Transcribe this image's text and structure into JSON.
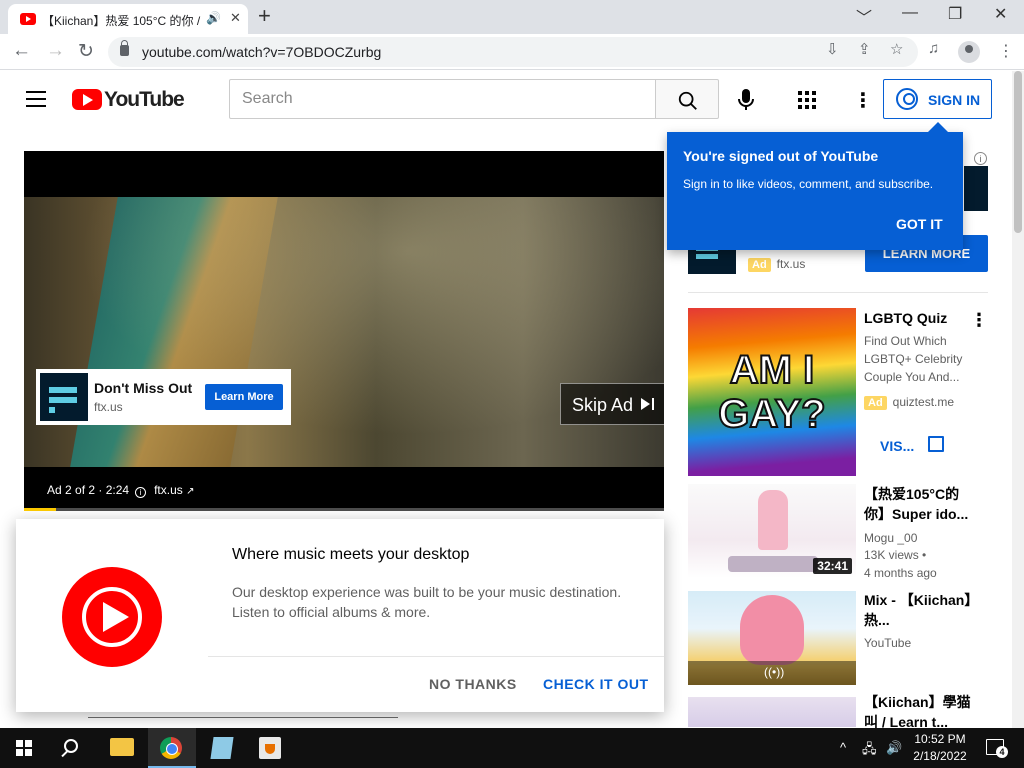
{
  "browser": {
    "tab_title": "【Kiichan】热爱 105°C 的你 /",
    "tab_audio_icon": "speaker-icon",
    "tab_close": "✕",
    "new_tab": "+",
    "window": {
      "minimize": "﹀",
      "min": "—",
      "restore": "❐",
      "close": "✕"
    },
    "nav": {
      "back": "←",
      "forward": "→",
      "reload": "↻"
    },
    "url": "youtube.com/watch?v=7OBDOCZurbg",
    "omni_icons": [
      "install-icon",
      "share-icon",
      "star-icon",
      "media-control-icon"
    ],
    "menu": "⋮"
  },
  "youtube": {
    "wordmark": "YouTube",
    "search_placeholder": "Search",
    "more": "⋮",
    "sign_in": "SIGN IN"
  },
  "player": {
    "ad_card": {
      "title": "Don't Miss Out",
      "domain": "ftx.us",
      "button": "Learn More"
    },
    "skip_ad": "Skip Ad",
    "ad_counter": "Ad 2 of 2 · 2:24",
    "ad_domain": "ftx.us",
    "info_glyph": "i",
    "external_glyph": "↗",
    "progress": 0.05,
    "accent_color": "#ffcc00"
  },
  "promo": {
    "title": "Where music meets your desktop",
    "body": "Our desktop experience was built to be your music destination. Listen to official albums & more.",
    "no_thanks": "NO THANKS",
    "check_it_out": "CHECK IT OUT"
  },
  "tooltip": {
    "heading": "You're signed out of YouTube",
    "body": "Sign in to like videos, comment, and subscribe.",
    "button": "GOT IT"
  },
  "companion": {
    "ad_badge": "Ad",
    "domain": "ftx.us",
    "button": "LEARN MORE",
    "info_glyph": "i"
  },
  "quiz_ad": {
    "thumb_text": "AM I GAY?",
    "title": "LGBTQ Quiz",
    "description": "Find Out Which LGBTQ+ Celebrity Couple You And...",
    "ad_badge": "Ad",
    "domain": "quiztest.me",
    "visit": "VIS...",
    "menu": "⋮"
  },
  "videos": [
    {
      "title": "【热爱105°C的你】Super ido...",
      "channel": "Mogu _00",
      "views": "13K views •",
      "age": "4 months ago",
      "duration": "32:41"
    },
    {
      "title": "Mix - 【Kiichan】热...",
      "channel": "YouTube",
      "live_glyph": "((•))"
    },
    {
      "title": "【Kiichan】學猫叫 / Learn t..."
    }
  ],
  "taskbar": {
    "time": "10:52 PM",
    "date": "2/18/2022",
    "tray_chevron": "^",
    "notification_count": "4",
    "tray_icons": [
      "network-icon",
      "volume-icon"
    ]
  },
  "colors": {
    "youtube_red": "#ff0000",
    "youtube_blue": "#065fd4",
    "ad_yellow": "#fdd663"
  }
}
